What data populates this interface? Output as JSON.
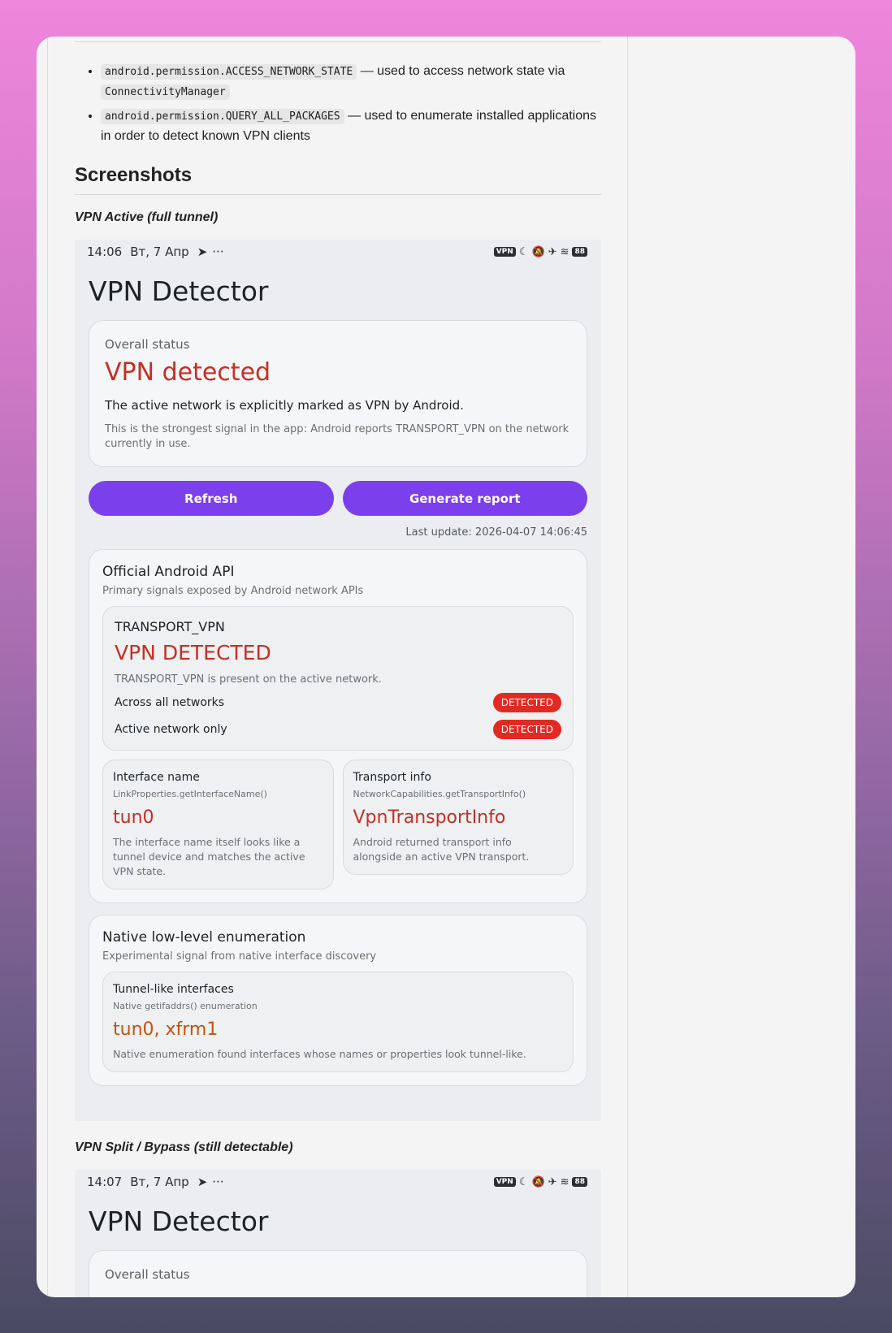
{
  "permissions": [
    {
      "code": "android.permission.ACCESS_NETWORK_STATE",
      "text": "— used to access network state via",
      "code2": "ConnectivityManager"
    },
    {
      "code": "android.permission.QUERY_ALL_PACKAGES",
      "text": "— used to enumerate installed applications in order to detect known VPN clients"
    }
  ],
  "heading": "Screenshots",
  "captions": [
    "VPN Active (full tunnel)",
    "VPN Split / Bypass (still detectable)"
  ],
  "shot1": {
    "statusbar": {
      "time": "14:06",
      "date": "Вт, 7 Апр",
      "vpn": "VPN",
      "battery": "88"
    },
    "app_title": "VPN Detector",
    "overall": {
      "label": "Overall status",
      "value": "VPN detected",
      "desc": "The active network is explicitly marked as VPN by Android.",
      "sub": "This is the strongest signal in the app: Android reports TRANSPORT_VPN on the network currently in use."
    },
    "buttons": {
      "refresh": "Refresh",
      "report": "Generate report"
    },
    "last_update": "Last update: 2026-04-07 14:06:45",
    "api": {
      "title": "Official Android API",
      "sub": "Primary signals exposed by Android network APIs",
      "transport": {
        "name": "TRANSPORT_VPN",
        "value": "VPN DETECTED",
        "desc": "TRANSPORT_VPN is present on the active network.",
        "rows": [
          {
            "label": "Across all networks",
            "status": "DETECTED"
          },
          {
            "label": "Active network only",
            "status": "DETECTED"
          }
        ]
      },
      "interface": {
        "title": "Interface name",
        "sub": "LinkProperties.getInterfaceName()",
        "value": "tun0",
        "desc": "The interface name itself looks like a tunnel device and matches the active VPN state."
      },
      "transport_info": {
        "title": "Transport info",
        "sub": "NetworkCapabilities.getTransportInfo()",
        "value": "VpnTransportInfo",
        "desc": "Android returned transport info alongside an active VPN transport."
      }
    },
    "native": {
      "title": "Native low-level enumeration",
      "sub": "Experimental signal from native interface discovery",
      "tunnel": {
        "title": "Tunnel-like interfaces",
        "sub": "Native getifaddrs() enumeration",
        "value": "tun0, xfrm1",
        "desc": "Native enumeration found interfaces whose names or properties look tunnel-like."
      }
    }
  },
  "shot2": {
    "statusbar": {
      "time": "14:07",
      "date": "Вт, 7 Апр",
      "vpn": "VPN",
      "battery": "88"
    },
    "app_title": "VPN Detector",
    "overall_label": "Overall status"
  },
  "colors": {
    "accent": "#7c3fec",
    "danger": "#c62f23",
    "pill": "#e32a22",
    "warning": "#c3530f"
  }
}
